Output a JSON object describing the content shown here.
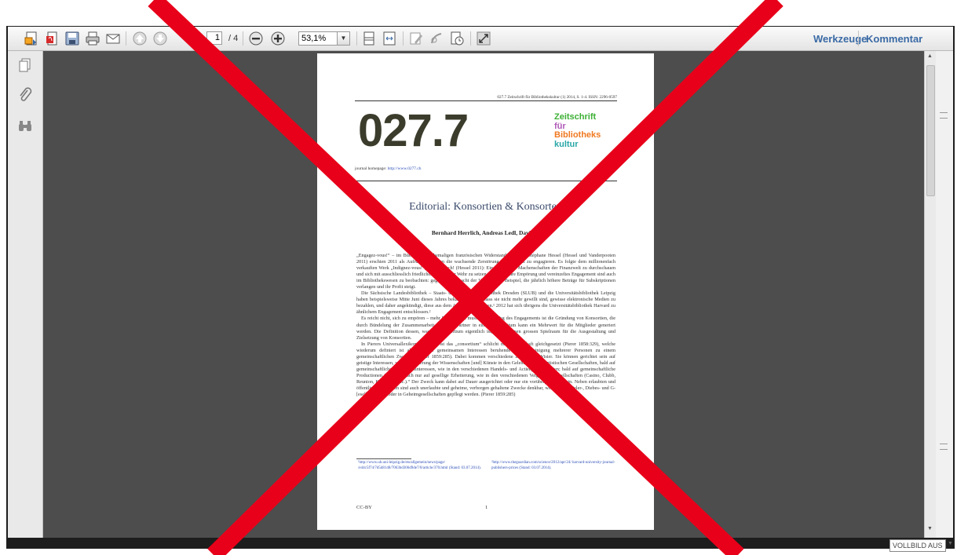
{
  "toolbar": {
    "page_current": "1",
    "page_total": "/ 4",
    "zoom": "53,1%",
    "tools": "Werkzeuge",
    "comment": "Kommentar"
  },
  "document": {
    "header_line": "027.7 Zeitschrift für Bibliothekskultur (1) 2014, S. 1-4. ISSN: 2296-0597",
    "logo_number": "027.7",
    "logo_words": [
      "Zeitschrift",
      "für",
      "Bibliotheks",
      "kultur"
    ],
    "homepage_label": "journal homepage:",
    "homepage_url": "http://www.0277.ch",
    "title": "Editorial: Konsortien & Konsorten",
    "authors": "Bernhard Herrlich, Andreas Ledl, David Z",
    "paragraphs": [
      "„Engagez-vous!“ – im Büchlein des ehemaligen französischen Widerstandskämpfers Stéphane Hessel (Hessel und Vanderpooten 2011) erschien 2011 als Aufruf, sich gegen die wachsende Zerstörung der Umwelt zu engagieren. Es folgte dem millionenfach verkauften Werk „Indignez-vous!“, Empört euch! (Hessel 2011): Ein Aufruf, die Machenschaften der Finanzwelt zu durchschauen und sich mit ausschliesslich friedlichen Mitteln zur Wehr zu setzen. Vergleichbare Empörung und vereinzeltes Engagement sind auch im Bibliothekswesen zu beobachten: gegen die Allmacht der Verlage zum Beispiel, die jährlich höhere Beträge für Subskriptionen verlangen und ihr Profit steigt.",
      "Die Sächsische Landesbibliothek – Staats- und Universitätsbibliothek Dresden (SLUB) und die Universitätsbibliothek Leipzig haben beispielsweise Mitte Juni dieses Jahres bekannt gegeben, dass sie nicht mehr gewillt sind, gewisse elektronische Medien zu bezahlen, und daher angekündigt, diese aus dem Angebot zu nehmen.¹ 2012 hat sich übrigens die Universitätsbibliothek Harvard zu ähnlichem Engagement entschlossen.²",
      "Es reicht nicht, sich zu empören – mehr Engagement muss her. Ein Weg des Engagements ist die Gründung von Konsortien, die durch Bündelung der Zusammenarbeit mehrerer Partner in einem Konsortium kann ein Mehrwert für die Mitglieder generiert werden. Die Definition dessen, was ein Konsortium eigentlich ist, erlaubt einen grossen Spielraum für die Ausgestaltung und Zielsetzung von Konsortien.",
      "In Pierers Universallexikon von 1858 ist das „consortium“ schlicht mit Gesellschaft gleichgesetzt (Pierer 1858:329), welche wiederum definiert ist als „die auf gemeinsamen Interessen beruhende freie Vereinigung mehrerer Personen zu einem gemeinschaftlichen Zwecke“ (Pierer 1859:285). Dabei kommen verschiedene Zwecke ins Visier. Sie können gerichtet sein auf geistige Interessen, wie die Förderung der Wissenschaften [und] Künste in den Gelehrten [und] Artistischen Gesellschaften, bald auf gemeinschaftliche Vermögensinteressen, wie in den verschiedenen Handels- und Actiengesellschaften; bald auf gemeinschaftliche Productionen (...); bald auch nur auf gesellige Erheiterung, wie in den verschiedenen Vergnügungsgesellschaften (Casino, Clubb, Reunion, Kränzchen etc.).“ Der Zweck kann dabei auf Dauer ausgerichtet oder nur ein vorübergehender sein. Neben erlaubten und öffentlichen Zwecken sind auch unerlaubte und geheime, verborgen gehaltene Zwecke denkbar, wie sie in „Spieler-, Diebes- und G-[esellschaft]en“ oder in Geheimgesellschaften gepflegt werden. (Pierer 1859:285)"
    ],
    "footnote1": "¹http://www.ub.uni-leipzig.de/ets/allgemein/news/page/ /e44c5f74/7d5d8148/7063bd306d9de7/0/article/370.html (Stand: 03.07.2014).",
    "footnote2": "²http://www.theguardian.com/science/2012/apr/24/ harvard-university-journal-publishers-prices (Stand: 03.07.2014).",
    "footer_license": "CC-BY",
    "footer_page": "1"
  },
  "status": {
    "fullscreen": "VOLLBILD AUS"
  },
  "colors": {
    "logo_number": "#3c3c2c",
    "zeitschrift": "#3cb034",
    "fuer": "#b05ab8",
    "bibliotheks": "#f07820",
    "kultur": "#2aa6a6",
    "link": "#3a6aa5",
    "cross": "#e8001a"
  },
  "icons": [
    "create-pdf-icon",
    "pdf-convert-icon",
    "save-icon",
    "print-icon",
    "email-icon",
    "page-up-icon",
    "page-down-icon",
    "zoom-out-icon",
    "zoom-in-icon",
    "fit-page-icon",
    "fit-width-icon",
    "sign-icon",
    "comment-icon",
    "stamp-icon",
    "fullscreen-icon",
    "pages-panel-icon",
    "attachments-icon",
    "search-binoculars-icon"
  ]
}
